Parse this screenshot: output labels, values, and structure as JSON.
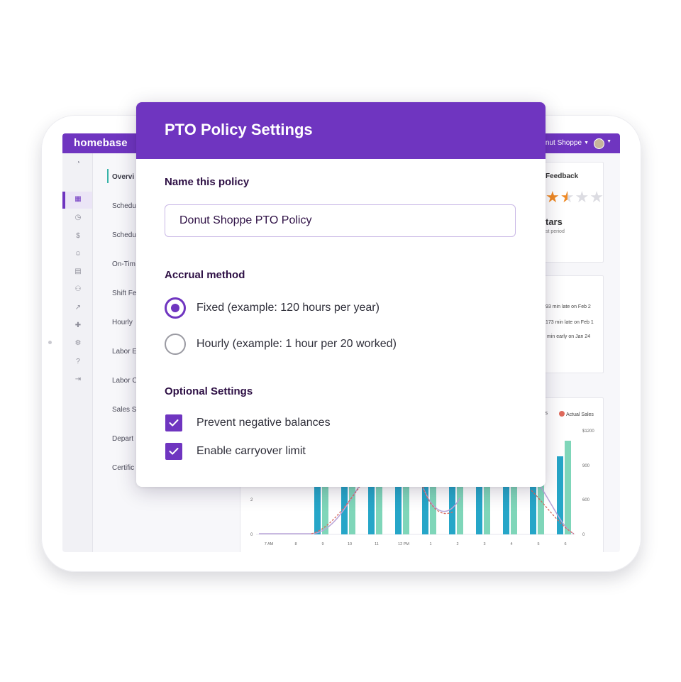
{
  "app": {
    "brand": "homebase",
    "location": "nut Shoppe"
  },
  "subnav": {
    "items": [
      "Overvi",
      "Schedu",
      "Schedu",
      "On-Tim",
      "Shift Fe",
      "Hourly",
      "Labor E",
      "Labor C",
      "Sales S",
      "Depart",
      "Certific"
    ]
  },
  "feedback": {
    "title": "Feedback",
    "rating": 2.5,
    "max_rating": 5,
    "stars_text": "tars",
    "period_text": "st period"
  },
  "late_list": [
    "93 min late on Feb 2",
    "173 min late on Feb 1",
    "min early on Jan 24"
  ],
  "chart_data": {
    "type": "bar",
    "categories": [
      "7 AM",
      "8",
      "9",
      "10",
      "11",
      "12 PM",
      "1",
      "2",
      "3",
      "4",
      "5",
      "6"
    ],
    "left_axis_ticks": [
      "0",
      "2"
    ],
    "right_axis_ticks": [
      "0",
      "600",
      "900",
      "$1200"
    ],
    "legend": [
      "les",
      "Actual Sales"
    ],
    "colors": {
      "bar_blue": "#26a6c8",
      "bar_green": "#7fd6b9",
      "line_purple": "#b9a3d8",
      "line_red": "#d66a5e"
    }
  },
  "modal": {
    "title": "PTO Policy Settings",
    "name_label": "Name this policy",
    "name_value": "Donut Shoppe PTO Policy",
    "accrual_label": "Accrual method",
    "accrual_options": [
      {
        "label": "Fixed (example: 120 hours per year)",
        "selected": true
      },
      {
        "label": "Hourly (example: 1 hour per 20 worked)",
        "selected": false
      }
    ],
    "optional_label": "Optional Settings",
    "optional_settings": [
      {
        "label": "Prevent negative balances",
        "checked": true
      },
      {
        "label": "Enable carryover limit",
        "checked": true
      }
    ]
  },
  "colors": {
    "brand_purple": "#6f35c0",
    "heading_dark": "#2e1045",
    "teal_marker": "#37b3a8",
    "star_orange": "#f08a24"
  }
}
